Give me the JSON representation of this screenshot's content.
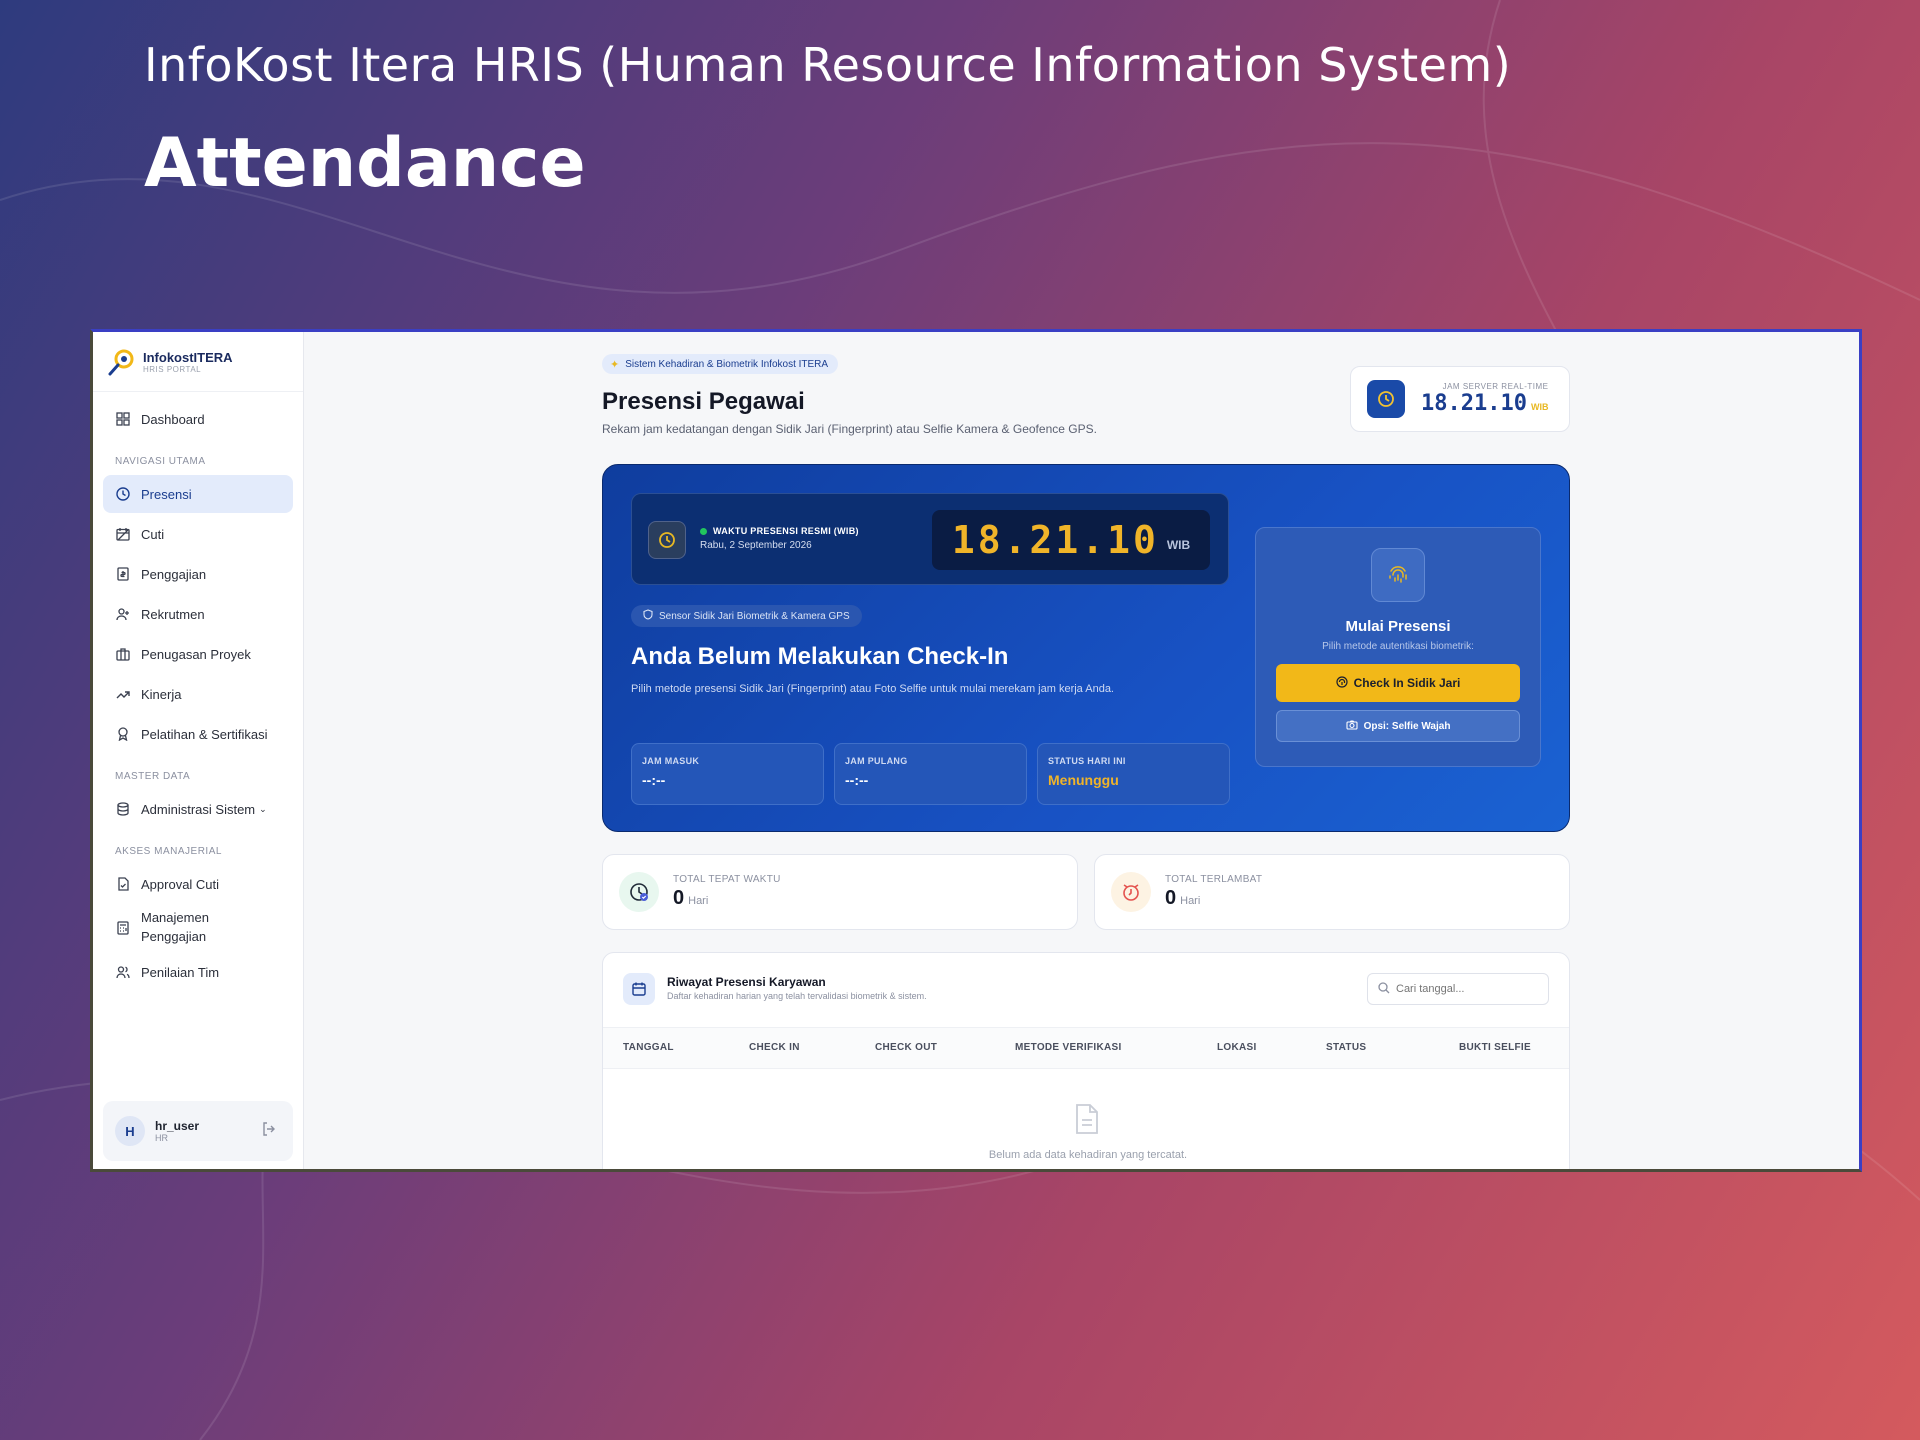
{
  "hero": {
    "subtitle": "InfoKost Itera HRIS (Human Resource Information System)",
    "title": "Attendance"
  },
  "brand": {
    "name": "InfokostITERA",
    "tagline": "HRIS PORTAL"
  },
  "sidebar": {
    "top_item": "Dashboard",
    "section_main": "NAVIGASI UTAMA",
    "main_items": [
      "Presensi",
      "Cuti",
      "Penggajian",
      "Rekrutmen",
      "Penugasan Proyek",
      "Kinerja",
      "Pelatihan & Sertifikasi"
    ],
    "section_master": "MASTER DATA",
    "master_items": [
      "Administrasi Sistem"
    ],
    "section_manager": "AKSES MANAJERIAL",
    "manager_items": [
      "Approval Cuti",
      "Manajemen Penggajian",
      "Penilaian Tim"
    ],
    "active": "Presensi"
  },
  "user": {
    "initial": "H",
    "name": "hr_user",
    "role": "HR"
  },
  "header": {
    "pill": "Sistem Kehadiran & Biometrik Infokost ITERA",
    "title": "Presensi Pegawai",
    "description": "Rekam jam kedatangan dengan Sidik Jari (Fingerprint) atau Selfie Kamera & Geofence GPS."
  },
  "server_clock": {
    "label": "JAM SERVER REAL-TIME",
    "time": "18.21.10",
    "zone": "WIB"
  },
  "panel": {
    "clock_label": "WAKTU PRESENSI RESMI (WIB)",
    "date": "Rabu, 2 September 2026",
    "time": "18.21.10",
    "zone": "WIB",
    "sensor_pill": "Sensor Sidik Jari Biometrik & Kamera GPS",
    "headline": "Anda Belum Melakukan Check-In",
    "description": "Pilih metode presensi Sidik Jari (Fingerprint) atau Foto Selfie untuk mulai merekam jam kerja Anda.",
    "stats": [
      {
        "label": "JAM MASUK",
        "value": "--:--"
      },
      {
        "label": "JAM PULANG",
        "value": "--:--"
      },
      {
        "label": "STATUS HARI INI",
        "value": "Menunggu"
      }
    ],
    "start_title": "Mulai Presensi",
    "start_sub": "Pilih metode autentikasi biometrik:",
    "btn_fingerprint": "Check In Sidik Jari",
    "btn_selfie": "Opsi: Selfie Wajah"
  },
  "summary": [
    {
      "label": "TOTAL TEPAT WAKTU",
      "value": "0",
      "unit": "Hari"
    },
    {
      "label": "TOTAL TERLAMBAT",
      "value": "0",
      "unit": "Hari"
    }
  ],
  "history": {
    "title": "Riwayat Presensi Karyawan",
    "subtitle": "Daftar kehadiran harian yang telah tervalidasi biometrik & sistem.",
    "search_placeholder": "Cari tanggal...",
    "columns": [
      "TANGGAL",
      "CHECK IN",
      "CHECK OUT",
      "METODE VERIFIKASI",
      "LOKASI",
      "STATUS",
      "BUKTI SELFIE"
    ],
    "empty_text": "Belum ada data kehadiran yang tercatat."
  },
  "colors": {
    "primary": "#1a4aa8",
    "accent": "#f2b818",
    "success": "#22c55e"
  }
}
